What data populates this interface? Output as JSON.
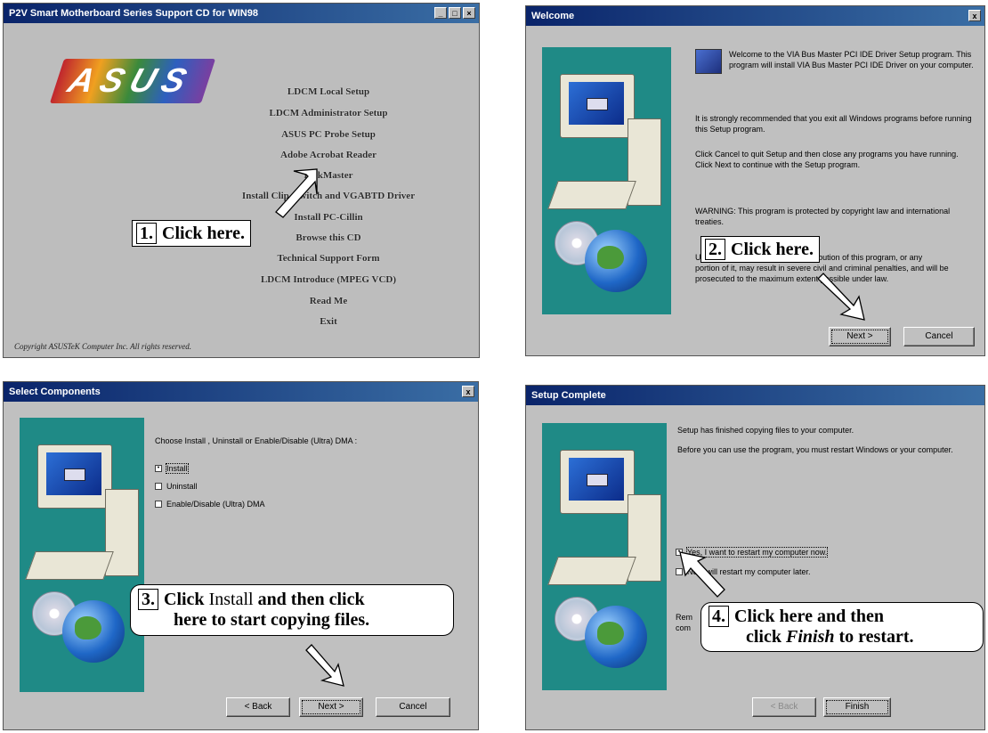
{
  "panel1": {
    "title": "P2V Smart Motherboard Series Support CD for WIN98",
    "logo_text": "ASUS",
    "menu": [
      "LDCM Local Setup",
      "LDCM Administrator Setup",
      "ASUS PC Probe Setup",
      "Adobe Acrobat Reader",
      "DiskMaster",
      "Install Clip, Switch and VGABTD Driver",
      "Install PC-Cillin",
      "Browse this CD",
      "Technical Support Form",
      "LDCM Introduce (MPEG VCD)",
      "Read Me",
      "Exit"
    ],
    "copyright": "Copyright ASUSTeK Computer Inc. All rights reserved.",
    "callout_num": "1.",
    "callout_text": "Click here."
  },
  "panel2": {
    "title": "Welcome",
    "close_glyph": "x",
    "para1": "Welcome to the VIA Bus Master PCI IDE Driver Setup program.  This program will install VIA Bus Master PCI IDE Driver on your computer.",
    "para2": "It is strongly recommended that you exit all Windows programs before running this Setup program.",
    "para3": "Click Cancel to quit Setup and then close any programs you have running.  Click Next to continue with the Setup program.",
    "para4": "WARNING: This program is protected by copyright law and international treaties.",
    "para5a": "Unauthorized reproduction or distribution of this program, or any",
    "para5b": "portion of it, may result in severe civil and criminal penalties, and will be prosecuted to the maximum extent possible under law.",
    "next_label": "Next >",
    "cancel_label": "Cancel",
    "callout_num": "2.",
    "callout_text": "Click here."
  },
  "panel3": {
    "title": "Select Components",
    "close_glyph": "x",
    "prompt": "Choose Install , Uninstall or Enable/Disable (Ultra) DMA :",
    "options": [
      "Install",
      "Uninstall",
      "Enable/Disable (Ultra) DMA"
    ],
    "back_label": "< Back",
    "next_label": "Next >",
    "cancel_label": "Cancel",
    "callout_num": "3.",
    "callout_line1_a": "Click",
    "callout_line1_b": "Install",
    "callout_line1_c": "and then click",
    "callout_line2": "here to start copying files."
  },
  "panel4": {
    "title": "Setup Complete",
    "line1": "Setup has finished copying files to your computer.",
    "line2": "Before you can use the program, you must restart Windows or your computer.",
    "option1": "Yes, I want to restart my computer now.",
    "option2": "No, I will restart my computer later.",
    "remove_text_a": "Rem",
    "remove_text_b": "com",
    "back_label": "< Back",
    "finish_label": "Finish",
    "callout_num": "4.",
    "callout_line1": "Click here and then",
    "callout_line2_a": "click",
    "callout_line2_b": "Finish",
    "callout_line2_c": "to restart."
  }
}
